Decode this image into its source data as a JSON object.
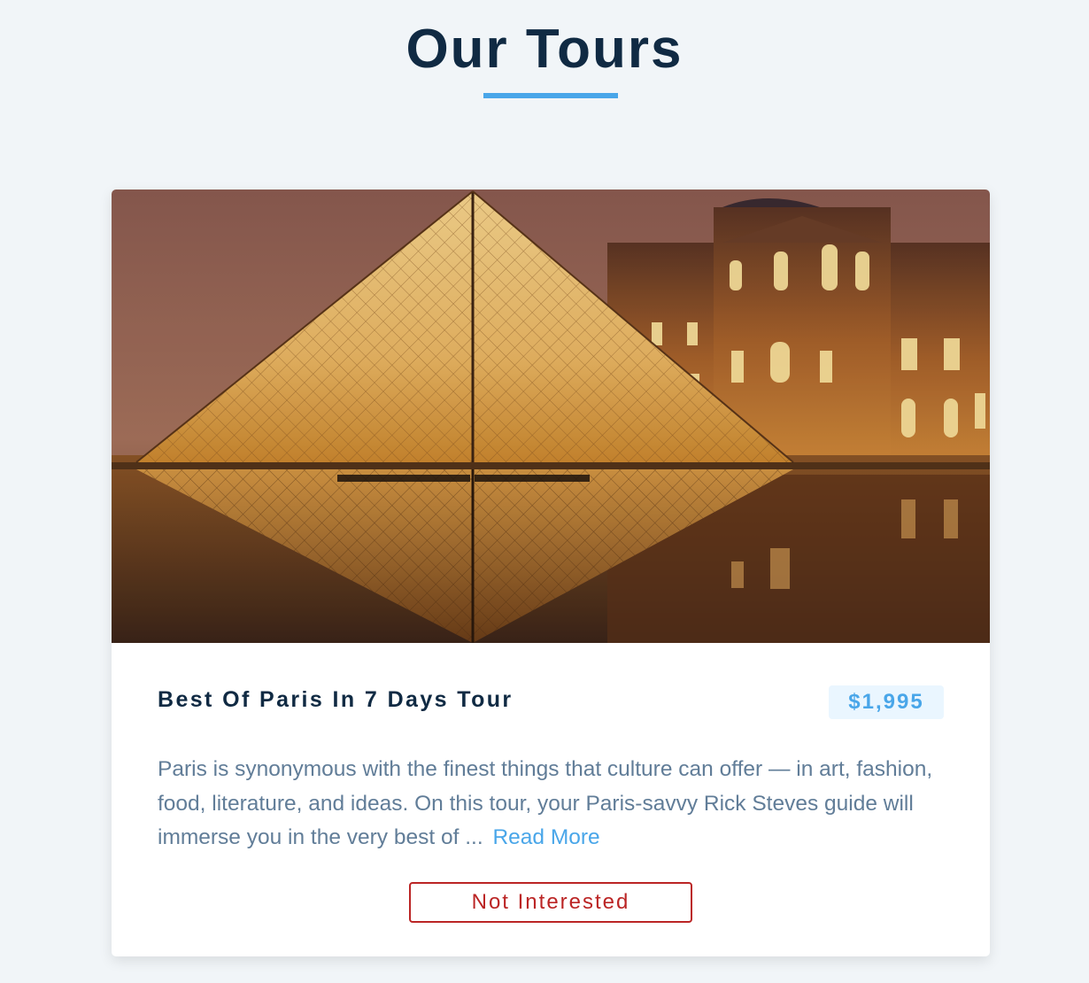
{
  "header": {
    "title": "Our Tours"
  },
  "tour": {
    "name": "Best Of Paris In 7 Days Tour",
    "price": "$1,995",
    "info": "Paris is synonymous with the finest things that culture can offer — in art, fashion, food, literature, and ideas. On this tour, your Paris-savvy Rick Steves guide will immerse you in the very best of ...",
    "read_more_label": "Read More",
    "not_interested_label": "Not Interested",
    "image_subject": "louvre-pyramid-night-photo"
  },
  "colors": {
    "background": "#f1f5f8",
    "title": "#102a43",
    "accent": "#49a6e9",
    "price_bg": "#eaf6ff",
    "text_muted": "#617d98",
    "danger": "#bb2525"
  }
}
